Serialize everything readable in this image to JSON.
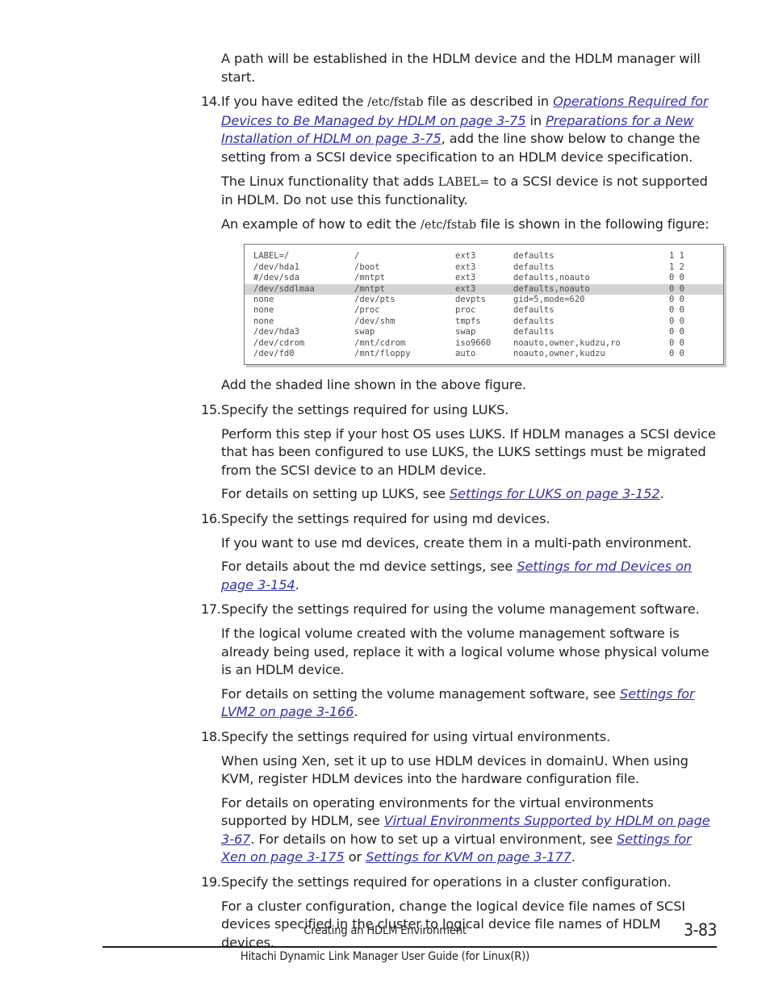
{
  "document": {
    "intro_paragraph": "A path will be established in the HDLM device and the HDLM manager will start.",
    "shaded_note": "Add the shaded line shown in the above figure."
  },
  "steps": [
    {
      "number": "14.",
      "parts": {
        "p1_a": "If you have edited the ",
        "p1_mono": "/etc/fstab",
        "p1_b": " file as described in ",
        "p1_link1": "Operations Required for Devices to Be Managed by HDLM on page 3-75",
        "p1_c": " in ",
        "p1_link2": "Preparations for a New Installation of HDLM on page 3-75",
        "p1_d": ", add the line show below to change the setting from a SCSI device specification to an HDLM device specification.",
        "p2_a": "The Linux functionality that adds ",
        "p2_mono": "LABEL=",
        "p2_b": " to a SCSI device is not supported in HDLM. Do not use this functionality.",
        "p3_a": "An example of how to edit the ",
        "p3_mono": "/etc/fstab",
        "p3_b": " file is shown in the following figure:"
      }
    },
    {
      "number": "15.",
      "title": "Specify the settings required for using LUKS.",
      "body": "Perform this step if your host OS uses LUKS. If HDLM manages a SCSI device that has been configured to use LUKS, the LUKS settings must be migrated from the SCSI device to an HDLM device.",
      "ref_prefix": "For details on setting up LUKS, see ",
      "ref_link": "Settings for LUKS on page 3-152",
      "ref_suffix": "."
    },
    {
      "number": "16.",
      "title": "Specify the settings required for using md devices.",
      "body": "If you want to use md devices, create them in a multi-path environment.",
      "ref_prefix": "For details about the md device settings, see ",
      "ref_link": "Settings for md Devices on page 3-154",
      "ref_suffix": "."
    },
    {
      "number": "17.",
      "title": "Specify the settings required for using the volume management software.",
      "body": "If the logical volume created with the volume management software is already being used, replace it with a logical volume whose physical volume is an HDLM device.",
      "ref_prefix": "For details on setting the volume management software, see ",
      "ref_link": "Settings for LVM2 on page 3-166",
      "ref_suffix": "."
    },
    {
      "number": "18.",
      "title": "Specify the settings required for using virtual environments.",
      "body": "When using Xen, set it up to use HDLM devices in domainU. When using KVM, register HDLM devices into the hardware configuration file.",
      "ref_prefix": "For details on operating environments for the virtual environments supported by HDLM, see ",
      "ref_link": "Virtual Environments Supported by HDLM on page 3-67",
      "ref_mid": ". For details on how to set up a virtual environment, see ",
      "ref_link2": "Settings for Xen on page 3-175",
      "ref_mid2": " or ",
      "ref_link3": "Settings for KVM on page 3-177",
      "ref_suffix": "."
    },
    {
      "number": "19.",
      "title": "Specify the settings required for operations in a cluster configuration.",
      "body": "For a cluster configuration, change the logical device file names of SCSI devices specified in the cluster to logical device file names of HDLM devices."
    }
  ],
  "figure": {
    "rows": [
      {
        "device": "LABEL=/",
        "mount": "/",
        "fstype": "ext3",
        "options": "defaults",
        "dumppass": "1 1",
        "shaded": false
      },
      {
        "device": "/dev/hda1",
        "mount": "/boot",
        "fstype": "ext3",
        "options": "defaults",
        "dumppass": "1 2",
        "shaded": false
      },
      {
        "device": "#/dev/sda",
        "mount": "/mntpt",
        "fstype": "ext3",
        "options": "defaults,noauto",
        "dumppass": "0 0",
        "shaded": false
      },
      {
        "device": "/dev/sddlmaa",
        "mount": "/mntpt",
        "fstype": "ext3",
        "options": "defaults,noauto",
        "dumppass": "0 0",
        "shaded": true
      },
      {
        "device": "none",
        "mount": "/dev/pts",
        "fstype": "devpts",
        "options": "gid=5,mode=620",
        "dumppass": "0 0",
        "shaded": false
      },
      {
        "device": "none",
        "mount": "/proc",
        "fstype": "proc",
        "options": "defaults",
        "dumppass": "0 0",
        "shaded": false
      },
      {
        "device": "none",
        "mount": "/dev/shm",
        "fstype": "tmpfs",
        "options": "defaults",
        "dumppass": "0 0",
        "shaded": false
      },
      {
        "device": "/dev/hda3",
        "mount": "swap",
        "fstype": "swap",
        "options": "defaults",
        "dumppass": "0 0",
        "shaded": false
      },
      {
        "device": "/dev/cdrom",
        "mount": "/mnt/cdrom",
        "fstype": "iso9660",
        "options": "noauto,owner,kudzu,ro",
        "dumppass": "0 0",
        "shaded": false
      },
      {
        "device": "/dev/fd0",
        "mount": "/mnt/floppy",
        "fstype": "auto",
        "options": "noauto,owner,kudzu",
        "dumppass": "0 0",
        "shaded": false
      }
    ],
    "shade_color": "#d3d3d3"
  },
  "footer": {
    "chapter": "Creating an HDLM Environment",
    "page_number": "3-83",
    "guide_title": "Hitachi Dynamic Link Manager User Guide (for Linux(R))"
  },
  "colors": {
    "link": "#3333a0",
    "text": "#231f20"
  }
}
